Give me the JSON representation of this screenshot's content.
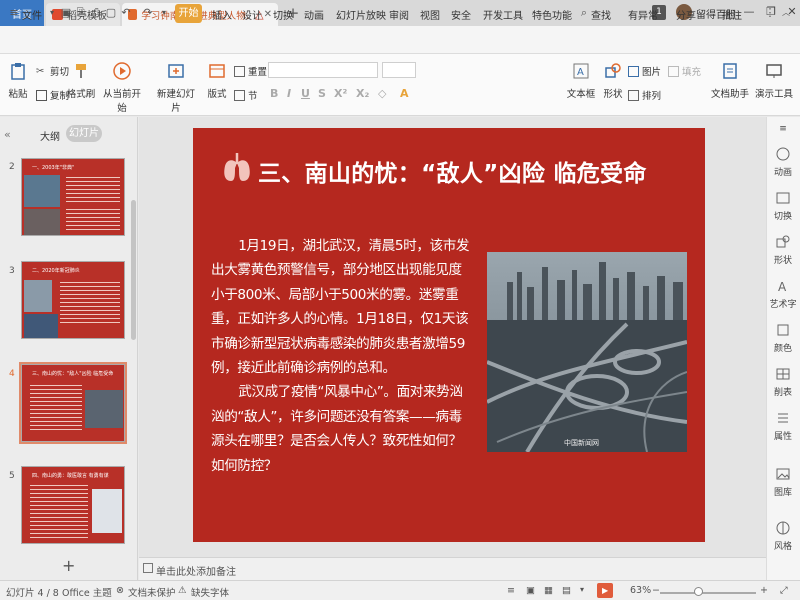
{
  "tabs": {
    "home": "首页",
    "template": "稻壳模板",
    "document": "学习钟南山先进典型人物.pptx",
    "page_count": "1",
    "user": "留得百胆"
  },
  "menu": {
    "file": "文件",
    "items": [
      "开始",
      "插入",
      "设计",
      "切换",
      "动画",
      "幻灯片放映",
      "审阅",
      "视图",
      "安全",
      "开发工具",
      "特色功能"
    ],
    "search": "查找",
    "right": [
      "有异常",
      "分享",
      "批注"
    ]
  },
  "ribbon": {
    "paste": "粘贴",
    "cut": "剪切",
    "copy": "复制",
    "format_painter": "格式刷",
    "from_current": "从当前开始",
    "new_slide": "新建幻灯片",
    "layout": "版式",
    "reset": "重置",
    "section": "节",
    "textbox": "文本框",
    "shape": "形状",
    "arrange": "排列",
    "picture": "图片",
    "fill": "填充",
    "doc_helper": "文档助手",
    "presenter": "演示工具"
  },
  "left_panel": {
    "tab_outline": "大纲",
    "tab_slides": "幻灯片",
    "slides": [
      {
        "num": "2",
        "title": "一、2003年\"非典\""
      },
      {
        "num": "3",
        "title": "二、2020年新冠肺炎"
      },
      {
        "num": "4",
        "title": "三、南山的忧：\"敌人\"凶险 临危受命"
      },
      {
        "num": "5",
        "title": "四、南山的勇：敢医敢言 有勇有谋"
      }
    ]
  },
  "slide": {
    "title": "三、南山的忧：“敌人”凶险  临危受命",
    "para1": "1月19日，湖北武汉，清晨5时，该市发出大雾黄色预警信号，部分地区出现能见度小于800米、局部小于500米的雾。迷雾重重，正如许多人的心情。1月18日，仅1天该市确诊新型冠状病毒感染的肺炎患者激增59例，接近此前确诊病例的总和。",
    "para2": "武汉成了疫情“风暴中心”。面对来势汹汹的“敌人”，许多问题还没有答案——病毒源头在哪里？是否会人传人？致死性如何？如何防控？",
    "photo_watermark": "中国新闻网"
  },
  "notes_placeholder": "单击此处添加备注",
  "right_sidebar": [
    "动画",
    "切换",
    "形状",
    "艺术字",
    "颜色",
    "削表",
    "属性",
    "图库",
    "风格"
  ],
  "status": {
    "slide_info": "幻灯片 4 / 8",
    "theme": "Office 主题",
    "doc_protect": "文档未保护",
    "missing_font": "缺失字体",
    "zoom": "63%"
  },
  "colors": {
    "slide_bg": "#b5281f",
    "start_tab": "#e8a43a",
    "home_tab": "#3a78c3"
  }
}
